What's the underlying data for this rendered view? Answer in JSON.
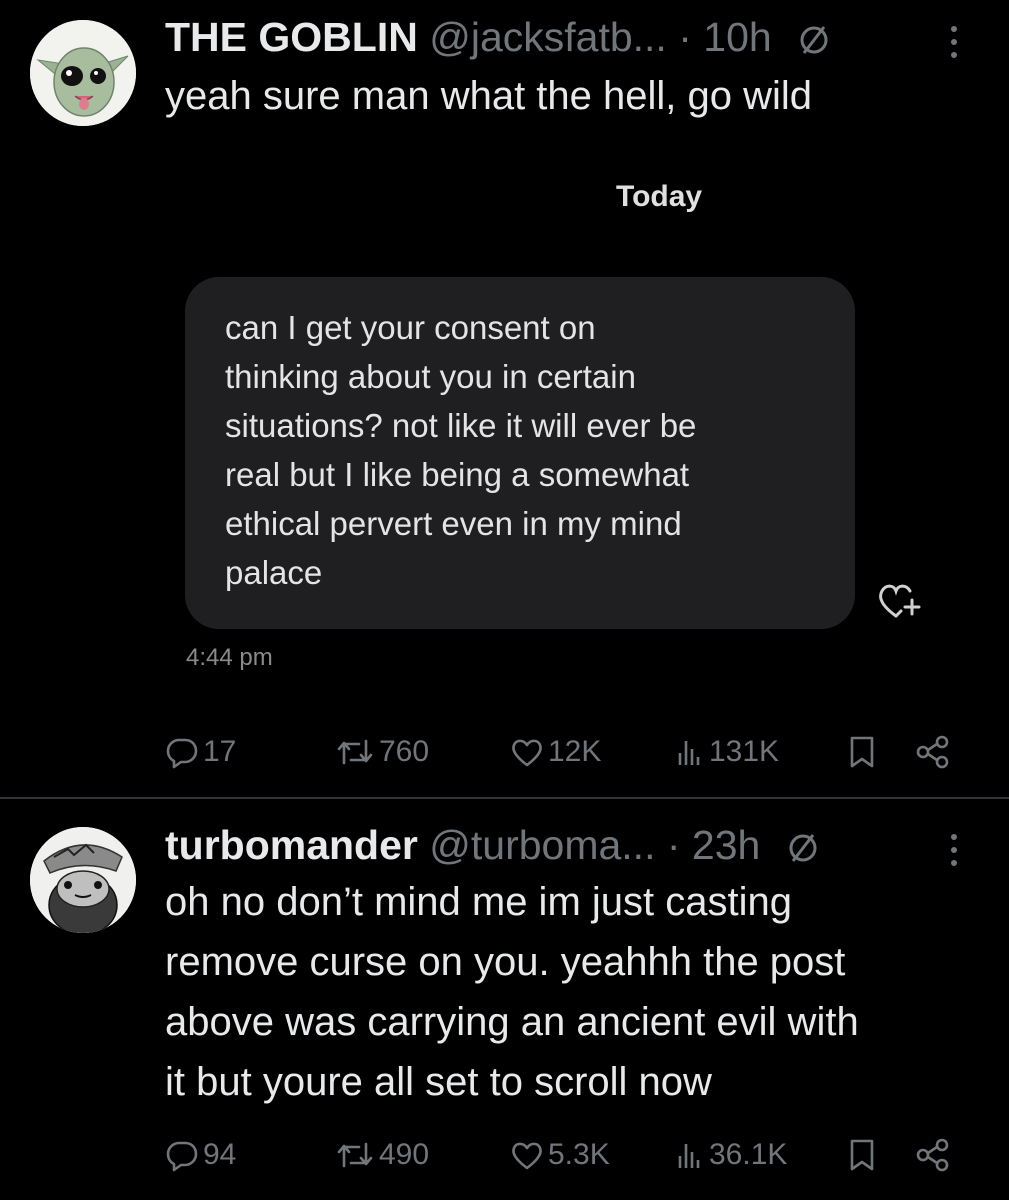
{
  "posts": [
    {
      "author": "THE GOBLIN",
      "handle": "@jacksfatb...",
      "time": "· 10h",
      "text": "yeah sure man what the hell, go wild",
      "embedded_dm": {
        "date_label": "Today",
        "message": "can I get your consent on\nthinking about you in certain\nsituations? not like it will ever be\nreal but I like being a somewhat\nethical pervert even in my mind\npalace",
        "time": "4:44 pm"
      },
      "stats": {
        "replies": "17",
        "reposts": "760",
        "likes": "12K",
        "views": "131K"
      }
    },
    {
      "author": "turbomander",
      "handle": "@turboma...",
      "time": "· 23h",
      "text": "oh no don’t mind me im just casting\nremove curse on you. yeahhh the post\nabove was carrying an ancient evil with\nit but youre all set to scroll now",
      "stats": {
        "replies": "94",
        "reposts": "490",
        "likes": "5.3K",
        "views": "36.1K"
      }
    }
  ],
  "icons": [
    "reply-icon",
    "repost-icon",
    "like-icon",
    "views-icon",
    "bookmark-icon",
    "share-icon",
    "more-icon",
    "no-symbol-icon",
    "heart-add-icon"
  ],
  "colors": {
    "background": "#000000",
    "text": "#e7e9ea",
    "muted": "#71767b",
    "bubble": "#1f1f21"
  }
}
